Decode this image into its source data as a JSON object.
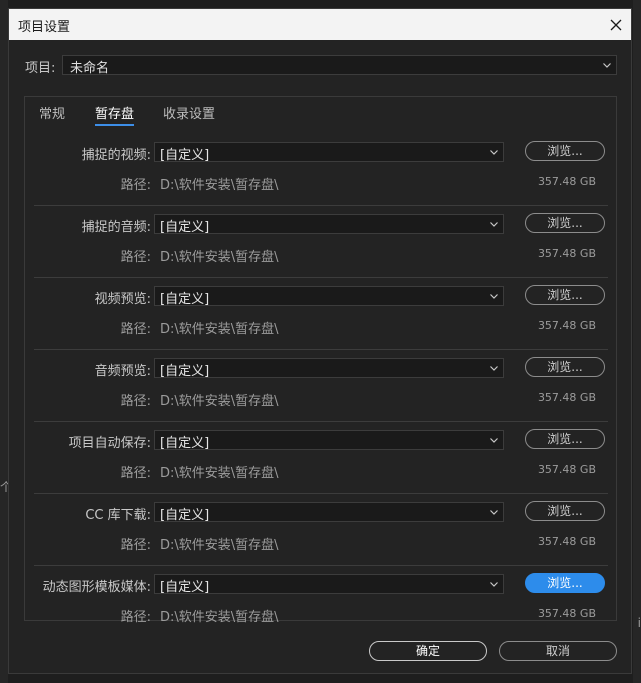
{
  "window": {
    "title": "项目设置"
  },
  "background": {
    "left_glyph": "个",
    "right_glyph": "i"
  },
  "project": {
    "label": "项目:",
    "value": "未命名"
  },
  "tabs": [
    {
      "label": "常规",
      "active": false
    },
    {
      "label": "暂存盘",
      "active": true
    },
    {
      "label": "收录设置",
      "active": false
    }
  ],
  "rows": [
    {
      "label": "捕捉的视频:",
      "value": "[自定义]",
      "browse": "浏览...",
      "path_label": "路径:",
      "path": "D:\\软件安装\\暂存盘\\",
      "size": "357.48 GB"
    },
    {
      "label": "捕捉的音频:",
      "value": "[自定义]",
      "browse": "浏览...",
      "path_label": "路径:",
      "path": "D:\\软件安装\\暂存盘\\",
      "size": "357.48 GB"
    },
    {
      "label": "视频预览:",
      "value": "[自定义]",
      "browse": "浏览...",
      "path_label": "路径:",
      "path": "D:\\软件安装\\暂存盘\\",
      "size": "357.48 GB"
    },
    {
      "label": "音频预览:",
      "value": "[自定义]",
      "browse": "浏览...",
      "path_label": "路径:",
      "path": "D:\\软件安装\\暂存盘\\",
      "size": "357.48 GB"
    },
    {
      "label": "项目自动保存:",
      "value": "[自定义]",
      "browse": "浏览...",
      "path_label": "路径:",
      "path": "D:\\软件安装\\暂存盘\\",
      "size": "357.48 GB"
    },
    {
      "label": "CC 库下载:",
      "value": "[自定义]",
      "browse": "浏览...",
      "path_label": "路径:",
      "path": "D:\\软件安装\\暂存盘\\",
      "size": "357.48 GB"
    },
    {
      "label": "动态图形模板媒体:",
      "value": "[自定义]",
      "browse": "浏览...",
      "path_label": "路径:",
      "path": "D:\\软件安装\\暂存盘\\",
      "size": "357.48 GB",
      "browse_primary": true
    }
  ],
  "footer": {
    "ok": "确定",
    "cancel": "取消"
  },
  "colors": {
    "accent": "#2d8ceb",
    "titlebar": "#f3f3f3",
    "dialog_bg": "#232323"
  }
}
